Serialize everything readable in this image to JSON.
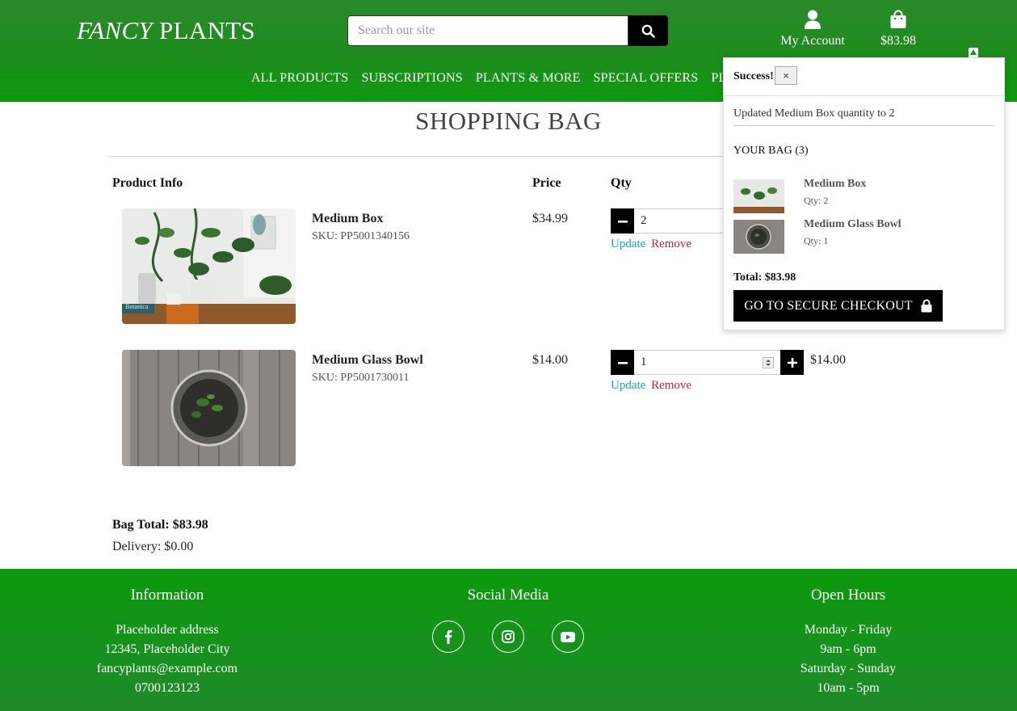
{
  "brand": {
    "logo_italic": "FANCY",
    "logo_rest": "PLANTS"
  },
  "search": {
    "placeholder": "Search our site"
  },
  "header": {
    "account_label": "My Account",
    "bag_total": "$83.98"
  },
  "nav": {
    "items": [
      "ALL PRODUCTS",
      "SUBSCRIPTIONS",
      "PLANTS & MORE",
      "SPECIAL OFFERS",
      "PLA"
    ]
  },
  "page": {
    "title": "SHOPPING BAG"
  },
  "table": {
    "headers": {
      "product": "Product Info",
      "price": "Price",
      "qty": "Qty"
    }
  },
  "items": [
    {
      "name": "Medium Box",
      "sku": "SKU: PP5001340156",
      "price": "$34.99",
      "qty": "2",
      "subtotal": "",
      "update": "Update",
      "remove": "Remove"
    },
    {
      "name": "Medium Glass Bowl",
      "sku": "SKU: PP5001730011",
      "price": "$14.00",
      "qty": "1",
      "subtotal": "$14.00",
      "update": "Update",
      "remove": "Remove"
    }
  ],
  "summary": {
    "bag_total": "Bag Total: $83.98",
    "delivery": "Delivery: $0.00"
  },
  "toast": {
    "title": "Success!",
    "close": "×",
    "message": "Updated Medium Box quantity to 2",
    "bag_heading": "YOUR BAG (3)",
    "items": [
      {
        "name": "Medium Box",
        "qty": "Qty: 2"
      },
      {
        "name": "Medium Glass Bowl",
        "qty": "Qty: 1"
      }
    ],
    "total": "Total: $83.98",
    "checkout": "GO TO SECURE CHECKOUT"
  },
  "footer": {
    "info": {
      "heading": "Information",
      "lines": [
        "Placeholder address",
        "12345, Placeholder City",
        "fancyplants@example.com",
        "0700123123"
      ]
    },
    "social": {
      "heading": "Social Media",
      "icons": [
        "facebook-icon",
        "instagram-icon",
        "youtube-icon"
      ]
    },
    "hours": {
      "heading": "Open Hours",
      "lines": [
        "Monday - Friday",
        "9am - 6pm",
        "Saturday - Sunday",
        "10am - 5pm"
      ]
    }
  },
  "colors": {
    "header_green": "#1e8c1e",
    "footer_green": "#0c9a0c",
    "update_link": "#17a2b8",
    "remove_link": "#c0283a"
  }
}
